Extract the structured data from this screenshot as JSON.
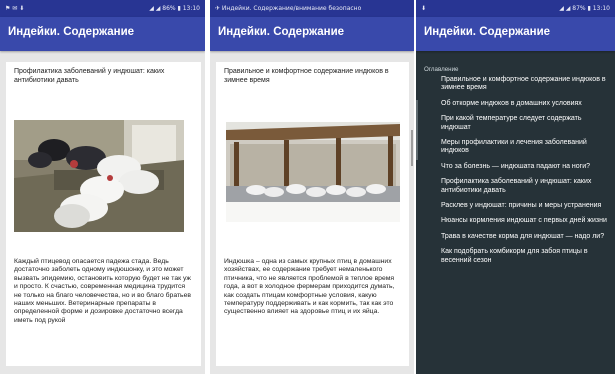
{
  "screen1": {
    "status_left": "⚑ ✉ ⬇",
    "status_right": "◢ ◢ 86% ▮ 13:10",
    "title": "Индейки. Содержание",
    "heading": "Профилактика заболеваний у индюшат: каких антибиотики давать",
    "photo_icon": "turkeys-in-pen-photo",
    "body": "Каждый птицевод опасается падежа стада. Ведь достаточно заболеть одному индюшонку, и это может вызвать эпидемию, остановить которую будет не так уж и просто. К счастью, современная медицина трудится не только на благо человечества, но и во благо братьев наших меньших. Ветеринарные препараты в определенной форме и дозировке достаточно всегда иметь под рукой"
  },
  "screen2": {
    "status_left": "✈ Индейки. Содержание/внимание безопасно",
    "title": "Индейки. Содержание",
    "heading": "Правильное и комфортное содержание индюков в зимнее время",
    "photo_icon": "turkeys-winter-shed-photo",
    "body": "Индюшка – одна из самых крупных птиц в домашних хозяйствах, ее содержание требует немаленького птичника, что не является проблемой в теплое время года, а вот в холодное фермерам приходится думать, как создать птицам комфортные условия, какую температуру поддерживать и как кормить, так как это существенно влияет на здоровье птиц и их яйца."
  },
  "screen3": {
    "status_left": "⬇",
    "status_right": "◢ ◢ 87% ▮ 13:10",
    "title": "Индейки. Содержание",
    "toc_label": "Оглавление",
    "toc_items": [
      "Правильное и комфортное содержание индюков в зимнее время",
      "Об откорме индюков в домашних условиях",
      "При какой температуре следует содержать индюшат",
      "Меры профилактики и лечения заболеваний индюков",
      "Что за болезнь — индюшата падают на ноги?",
      "Профилактика заболеваний у индюшат: каких антибиотики давать",
      "Расклев у индюшат: причины и меры устранения",
      "Нюансы кормления индюшат с первых дней жизни",
      "Трава в качестве корма для индюшат — надо ли?",
      "Как подобрать комбикорм для забоя птицы в весенний сезон"
    ]
  },
  "colors": {
    "statusbar": "#283593",
    "appbar": "#3949ab",
    "card": "#ffffff",
    "drawer": "#263238"
  }
}
